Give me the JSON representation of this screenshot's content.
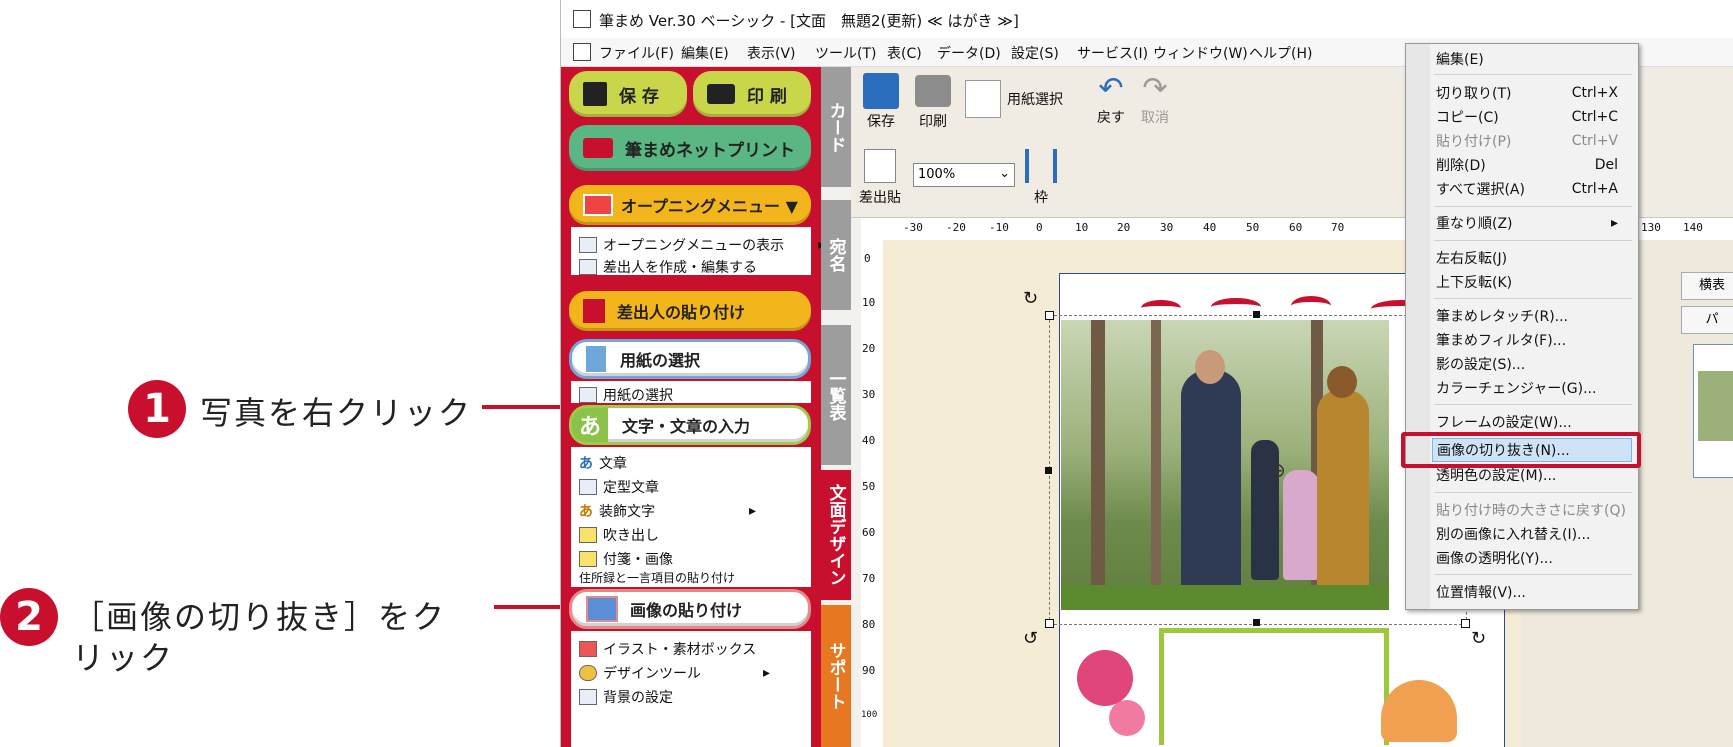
{
  "window": {
    "title": "筆まめ Ver.30 ベーシック - [文面　無題2(更新) ≪ はがき ≫]",
    "menu": [
      "ファイル(F)",
      "編集(E)",
      "表示(V)",
      "ツール(T)",
      "表(C)",
      "データ(D)",
      "設定(S)",
      "サービス(I)",
      "ウィンドウ(W)",
      "ヘルプ(H)"
    ]
  },
  "annotations": {
    "step1": {
      "num": "1",
      "text": "写真を右クリック"
    },
    "step2": {
      "num": "2",
      "line1": "［画像の切り抜き］をク",
      "line2": "リック"
    }
  },
  "left_panel": {
    "save": "保 存",
    "print": "印 刷",
    "netprint": "筆まめネットプリント",
    "opening_menu": "オープニングメニュー ▼",
    "opening_items": [
      "オープニングメニューの表示",
      "差出人を作成・編集する"
    ],
    "sender_paste": "差出人の貼り付け",
    "paper_select": "用紙の選択",
    "paper_select_item": "用紙の選択",
    "text_input": "文字・文章の入力",
    "text_items": [
      "文章",
      "定型文章",
      "装飾文字",
      "吹き出し",
      "付箋・画像",
      "住所録と一言項目の貼り付け"
    ],
    "image_paste": "画像の貼り付け",
    "image_items": [
      "イラスト・素材ボックス",
      "デザインツール",
      "背景の設定"
    ]
  },
  "tabs": {
    "card": "カード",
    "address": "宛名",
    "list": "一覧表",
    "design": "文面デザイン",
    "support": "サポート"
  },
  "toolbar": {
    "save": "保存",
    "print": "印刷",
    "paper": "用紙選択",
    "undo": "戻す",
    "redo": "取消",
    "sender": "差出貼",
    "zoom": "100%",
    "frame": "枠"
  },
  "ruler": {
    "h_ticks": [
      "-30",
      "-20",
      "-10",
      "0",
      "10",
      "20",
      "30",
      "40",
      "50",
      "60",
      "70",
      "130",
      "140"
    ],
    "v_ticks": [
      "0",
      "10",
      "20",
      "30",
      "40",
      "50",
      "60",
      "70",
      "80",
      "90",
      "100"
    ]
  },
  "right_buttons": [
    "横表",
    "パ"
  ],
  "context_menu": {
    "items": [
      {
        "label": "編集(E)",
        "shortcut": "",
        "disabled": false
      },
      {
        "label": "切り取り(T)",
        "shortcut": "Ctrl+X",
        "disabled": false
      },
      {
        "label": "コピー(C)",
        "shortcut": "Ctrl+C",
        "disabled": false
      },
      {
        "label": "貼り付け(P)",
        "shortcut": "Ctrl+V",
        "disabled": true
      },
      {
        "label": "削除(D)",
        "shortcut": "Del",
        "disabled": false
      },
      {
        "label": "すべて選択(A)",
        "shortcut": "Ctrl+A",
        "disabled": false
      },
      {
        "label": "重なり順(Z)",
        "shortcut": "▸",
        "disabled": false
      },
      {
        "label": "左右反転(J)",
        "shortcut": "",
        "disabled": false
      },
      {
        "label": "上下反転(K)",
        "shortcut": "",
        "disabled": false
      },
      {
        "label": "筆まめレタッチ(R)...",
        "shortcut": "",
        "disabled": false
      },
      {
        "label": "筆まめフィルタ(F)...",
        "shortcut": "",
        "disabled": false
      },
      {
        "label": "影の設定(S)...",
        "shortcut": "",
        "disabled": false
      },
      {
        "label": "カラーチェンジャー(G)...",
        "shortcut": "",
        "disabled": false
      },
      {
        "label": "フレームの設定(W)...",
        "shortcut": "",
        "disabled": false
      },
      {
        "label": "画像の切り抜き(N)...",
        "shortcut": "",
        "disabled": false
      },
      {
        "label": "透明色の設定(M)...",
        "shortcut": "",
        "disabled": false
      },
      {
        "label": "貼り付け時の大きさに戻す(Q)",
        "shortcut": "",
        "disabled": true
      },
      {
        "label": "別の画像に入れ替え(I)...",
        "shortcut": "",
        "disabled": false
      },
      {
        "label": "画像の透明化(Y)...",
        "shortcut": "",
        "disabled": false
      },
      {
        "label": "位置情報(V)...",
        "shortcut": "",
        "disabled": false
      }
    ]
  },
  "colors": {
    "accent": "#c8102e",
    "highlight": "#cfe3f7"
  }
}
